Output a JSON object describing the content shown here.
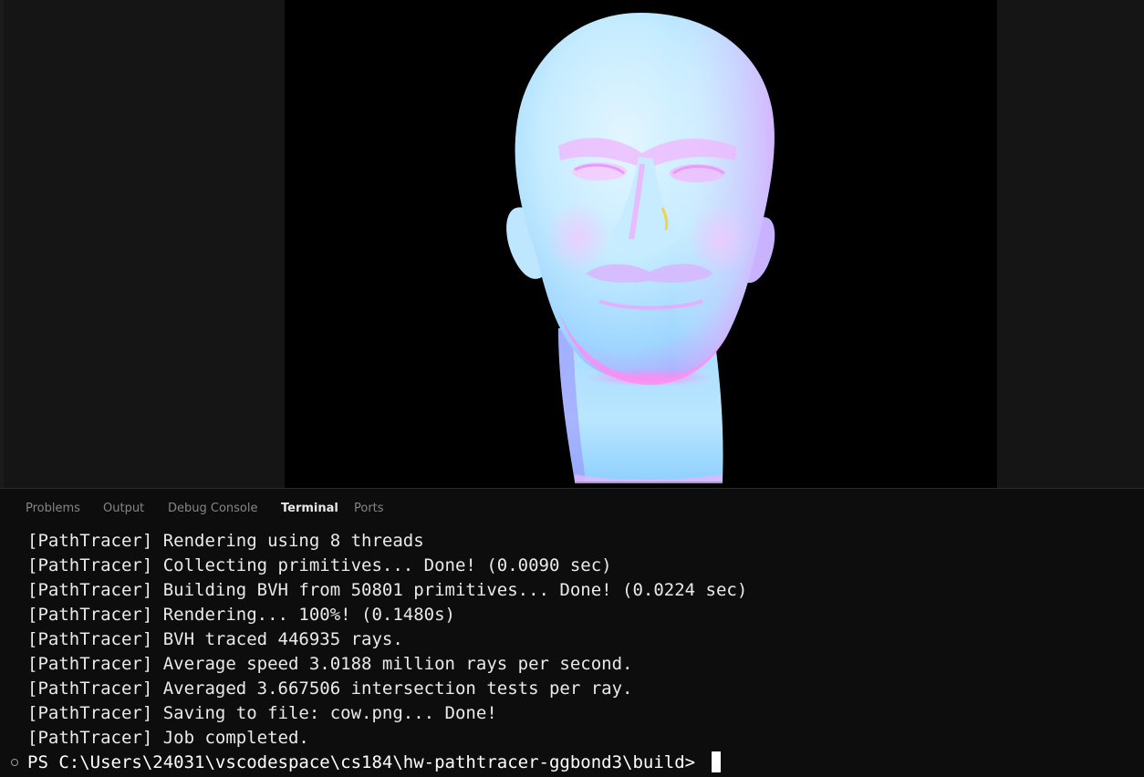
{
  "preview": {
    "image_name": "cow.png",
    "subject": "normal-shaded head bust render"
  },
  "panel": {
    "tabs": [
      {
        "label": "Problems",
        "active": false
      },
      {
        "label": "Output",
        "active": false
      },
      {
        "label": "Debug Console",
        "active": false
      },
      {
        "label": "Terminal",
        "active": true
      },
      {
        "label": "Ports",
        "active": false
      }
    ]
  },
  "terminal": {
    "lines": [
      "[PathTracer] Rendering using 8 threads",
      "[PathTracer] Collecting primitives... Done! (0.0090 sec)",
      "[PathTracer] Building BVH from 50801 primitives... Done! (0.0224 sec)",
      "[PathTracer] Rendering... 100%! (0.1480s)",
      "[PathTracer] BVH traced 446935 rays.",
      "[PathTracer] Average speed 3.0188 million rays per second.",
      "[PathTracer] Averaged 3.667506 intersection tests per ray.",
      "[PathTracer] Saving to file: cow.png... Done!",
      "[PathTracer] Job completed."
    ],
    "prompt": "PS C:\\Users\\24031\\vscodespace\\cs184\\hw-pathtracer-ggbond3\\build> "
  },
  "colors": {
    "terminal_background": "#0d0d0d",
    "render_background": "#000000",
    "active_tab": "#e7e7e7",
    "inactive_tab": "#858585",
    "text": "#eaeaea"
  }
}
